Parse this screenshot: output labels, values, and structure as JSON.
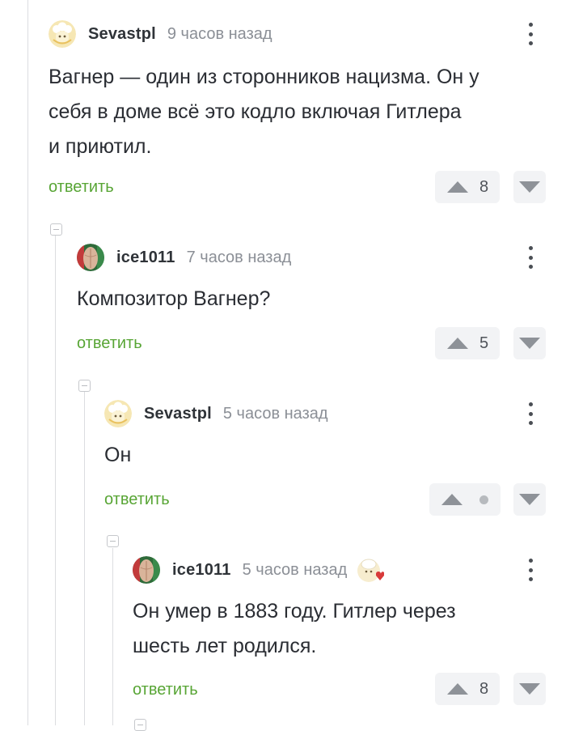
{
  "comments": [
    {
      "author": "Sevastpl",
      "time": "9 часов назад",
      "text_lines": [
        "Вагнер — один из сторонников нацизма. Он у",
        "себя в доме всё это кодло включая Гитлера",
        "и приютил."
      ],
      "reply_label": "ответить",
      "votes": "8",
      "avatar": "sheep-avatar-icon"
    },
    {
      "author": "ice1011",
      "time": "7 часов назад",
      "text_lines": [
        "Композитор Вагнер?"
      ],
      "reply_label": "ответить",
      "votes": "5",
      "avatar": "photo-avatar"
    },
    {
      "author": "Sevastpl",
      "time": "5 часов назад",
      "text_lines": [
        "Он"
      ],
      "reply_label": "ответить",
      "votes": "",
      "avatar": "sheep-avatar-icon"
    },
    {
      "author": "ice1011",
      "time": "5 часов назад",
      "text_lines": [
        "Он умер в 1883 году. Гитлер через",
        "шесть лет родился."
      ],
      "reply_label": "ответить",
      "votes": "8",
      "avatar": "photo-avatar",
      "badge": "chef-heart-badge-icon"
    }
  ],
  "colors": {
    "reply_green": "#58a535",
    "vote_bg": "#f2f3f5",
    "arrow_gray": "#8e9298",
    "thread_line": "#dcdde0"
  }
}
